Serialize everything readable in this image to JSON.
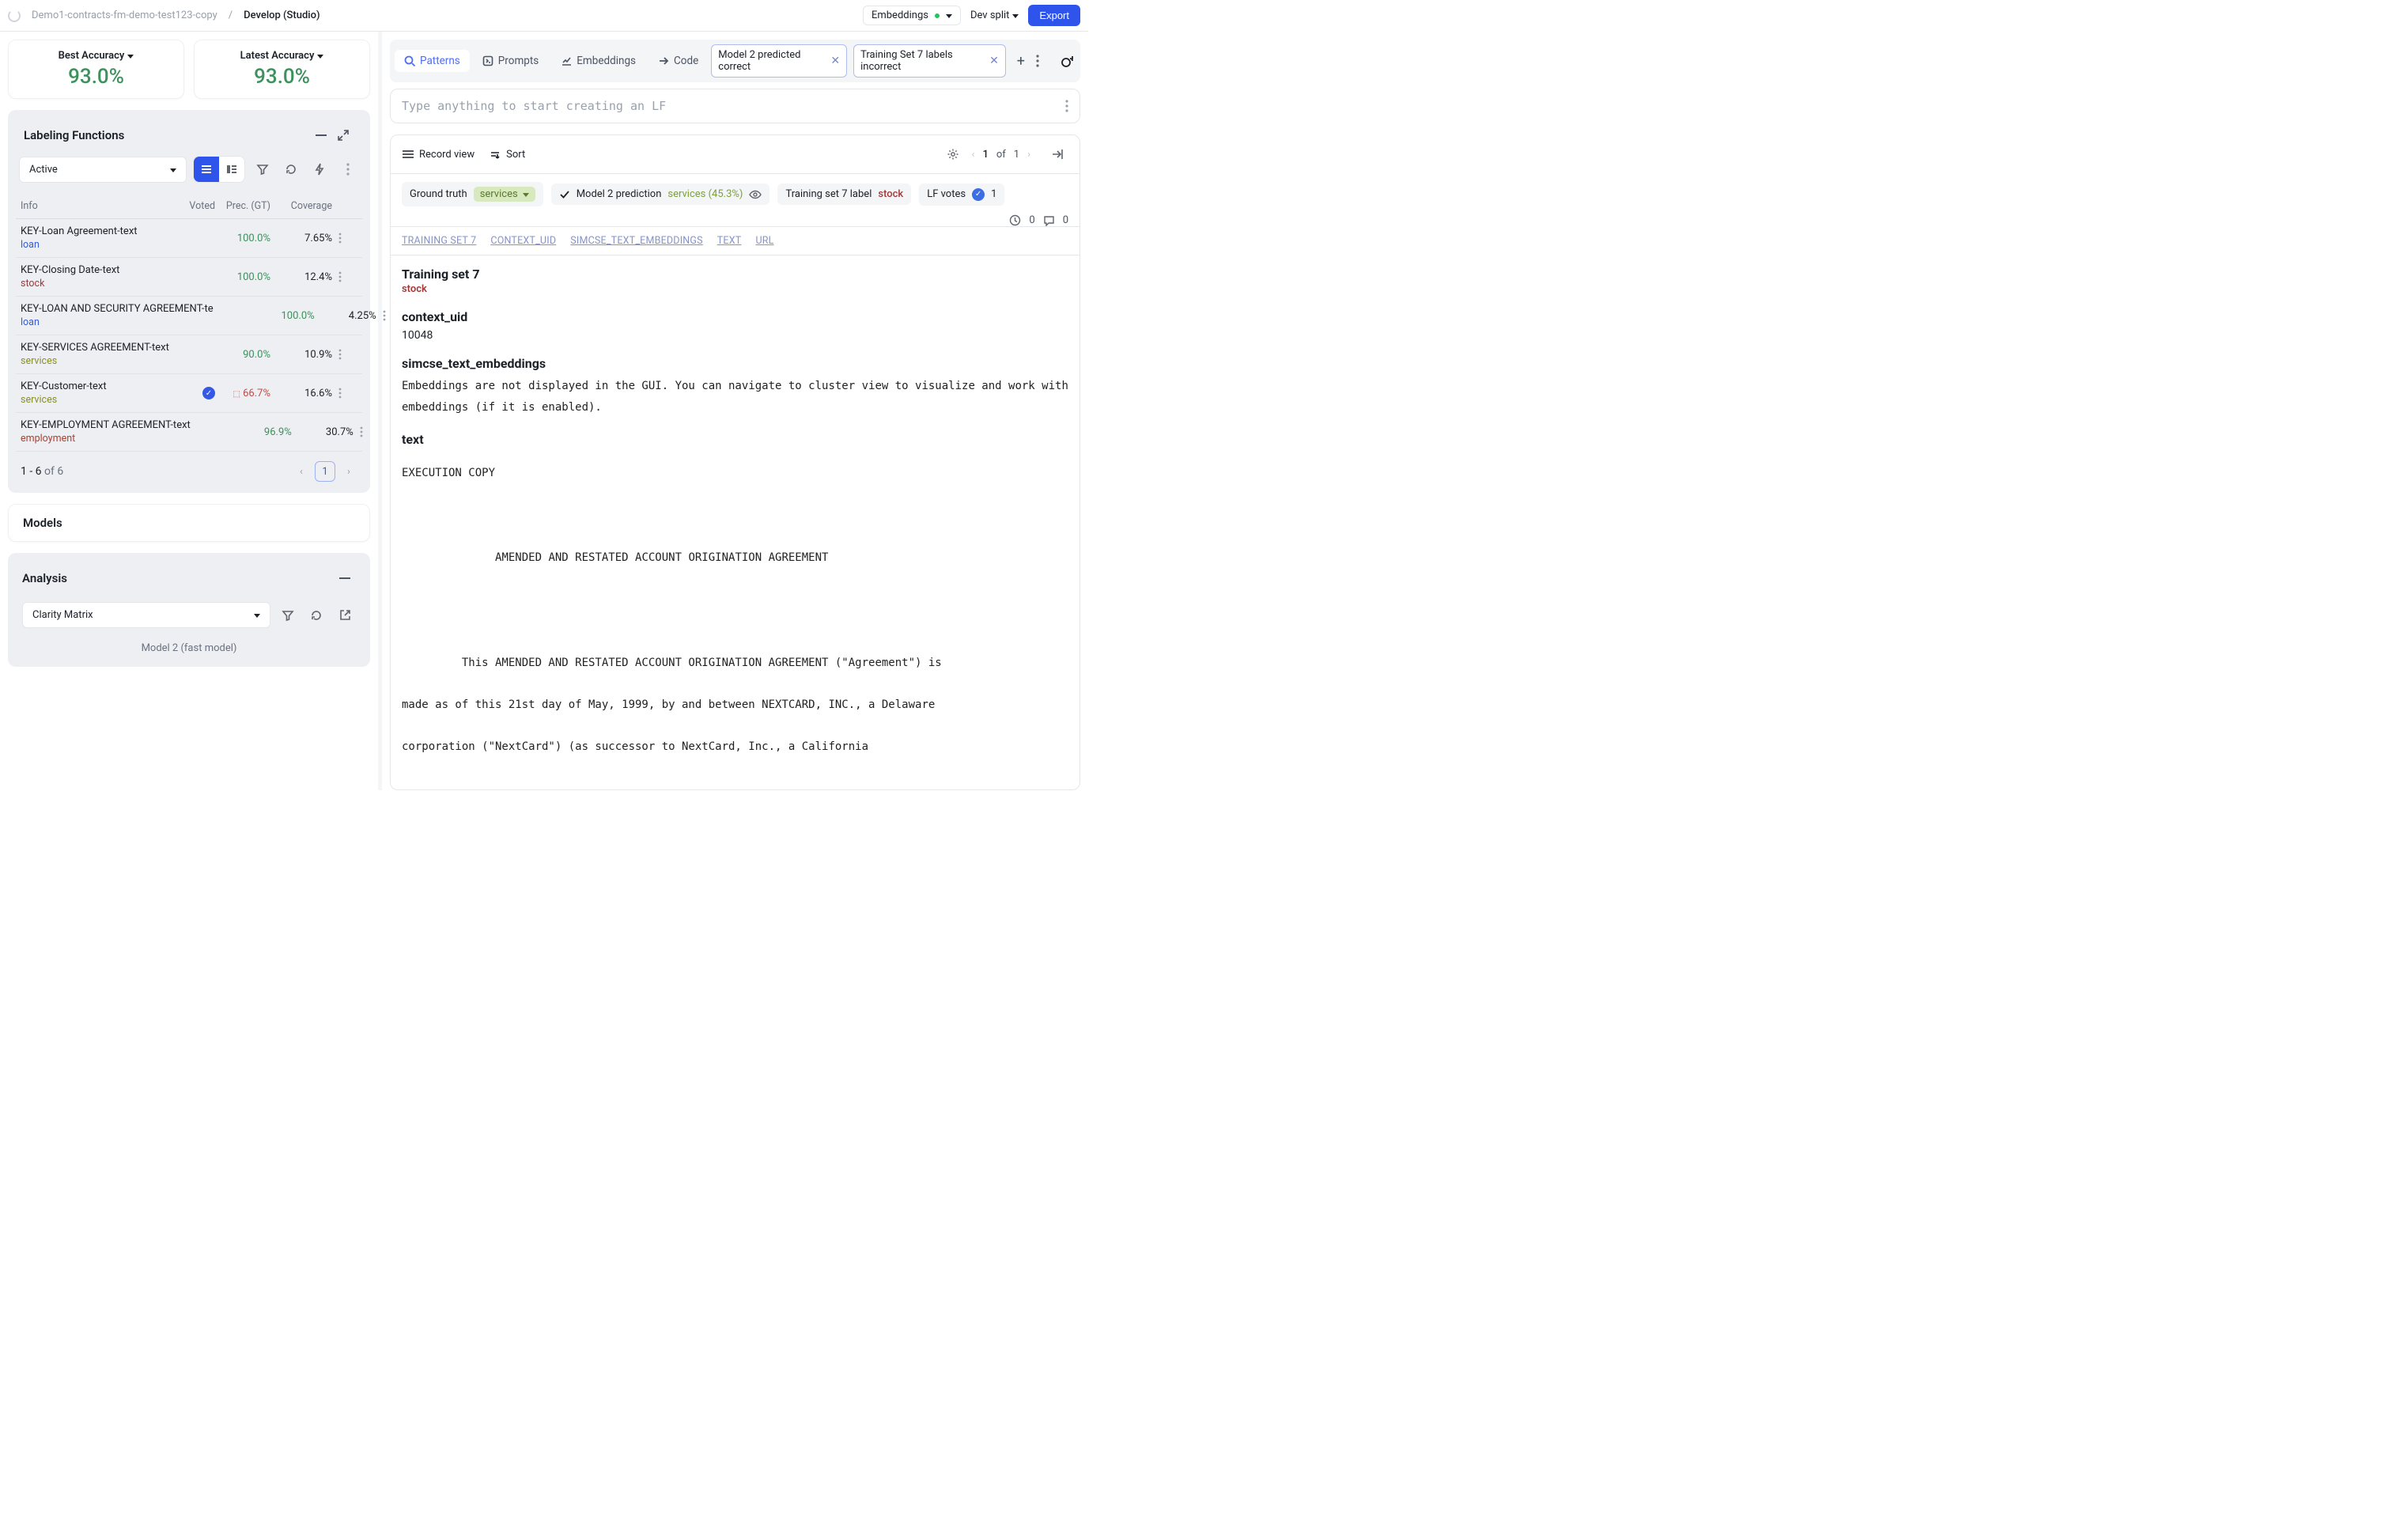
{
  "topbar": {
    "breadcrumb1": "Demo1-contracts-fm-demo-test123-copy",
    "breadcrumb2": "Develop (Studio)",
    "embeddings_label": "Embeddings",
    "devsplit_label": "Dev split",
    "export_label": "Export"
  },
  "accuracy": {
    "best_label": "Best Accuracy",
    "best_value": "93.0%",
    "latest_label": "Latest Accuracy",
    "latest_value": "93.0%"
  },
  "lf_panel": {
    "title": "Labeling Functions",
    "filter_select": "Active",
    "header_info": "Info",
    "header_voted": "Voted",
    "header_prec": "Prec. (GT)",
    "header_cov": "Coverage",
    "rows": [
      {
        "name": "KEY-Loan Agreement-text",
        "tag": "loan",
        "tag_class": "tag-loan",
        "voted": "",
        "prec": "100.0%",
        "prec_class": "green",
        "cov": "7.65%"
      },
      {
        "name": "KEY-Closing Date-text",
        "tag": "stock",
        "tag_class": "tag-stock",
        "voted": "",
        "prec": "100.0%",
        "prec_class": "green",
        "cov": "12.4%"
      },
      {
        "name": "KEY-LOAN AND SECURITY AGREEMENT-te",
        "tag": "loan",
        "tag_class": "tag-loan",
        "voted": "",
        "prec": "100.0%",
        "prec_class": "green",
        "cov": "4.25%"
      },
      {
        "name": "KEY-SERVICES AGREEMENT-text",
        "tag": "services",
        "tag_class": "tag-services",
        "voted": "",
        "prec": "90.0%",
        "prec_class": "green",
        "cov": "10.9%"
      },
      {
        "name": "KEY-Customer-text",
        "tag": "services",
        "tag_class": "tag-services",
        "voted": "✓",
        "prec": "66.7%",
        "prec_class": "red",
        "cov": "16.6%"
      },
      {
        "name": "KEY-EMPLOYMENT AGREEMENT-text",
        "tag": "employment",
        "tag_class": "tag-employment",
        "voted": "",
        "prec": "96.9%",
        "prec_class": "green",
        "cov": "30.7%"
      }
    ],
    "pager_range": "1 - 6",
    "pager_of": "of",
    "pager_total": "6",
    "page_num": "1"
  },
  "models_title": "Models",
  "analysis": {
    "title": "Analysis",
    "select": "Clarity Matrix",
    "footer": "Model 2 (fast model)"
  },
  "tabs": {
    "patterns": "Patterns",
    "prompts": "Prompts",
    "embeddings": "Embeddings",
    "code": "Code"
  },
  "chips": {
    "c1": "Model 2 predicted correct",
    "c2": "Training Set 7 labels incorrect"
  },
  "lf_input_placeholder": "Type anything to start creating an LF",
  "rec_toolbar": {
    "record_view": "Record view",
    "sort": "Sort",
    "page_current": "1",
    "page_of": "of",
    "page_total": "1"
  },
  "meta": {
    "gt_label": "Ground truth",
    "gt_value": "services",
    "pred_label": "Model 2 prediction",
    "pred_value": "services (45.3%)",
    "ts_label": "Training set 7 label",
    "ts_value": "stock",
    "lfvotes_label": "LF votes",
    "lfvotes_value": "1",
    "clock_count": "0",
    "comment_count": "0"
  },
  "field_links": {
    "l1": "TRAINING SET 7",
    "l2": "CONTEXT_UID",
    "l3": "SIMCSE_TEXT_EMBEDDINGS",
    "l4": "TEXT",
    "l5": "URL"
  },
  "record": {
    "ts7_title": "Training set 7",
    "ts7_value": "stock",
    "ctx_title": "context_uid",
    "ctx_value": "10048",
    "emb_title": "simcse_text_embeddings",
    "emb_value": "Embeddings are not displayed in the GUI. You can navigate to cluster view to visualize and work with embeddings (if it is enabled).",
    "text_title": "text",
    "text_body": "EXECUTION COPY\n\n\n\n              AMENDED AND RESTATED ACCOUNT ORIGINATION AGREEMENT\n\n\n\n\n         This AMENDED AND RESTATED ACCOUNT ORIGINATION AGREEMENT (\"Agreement\") is\n\nmade as of this 21st day of May, 1999, by and between NEXTCARD, INC., a Delaware\n\ncorporation (\"NextCard\") (as successor to NextCard, Inc., a California"
  }
}
